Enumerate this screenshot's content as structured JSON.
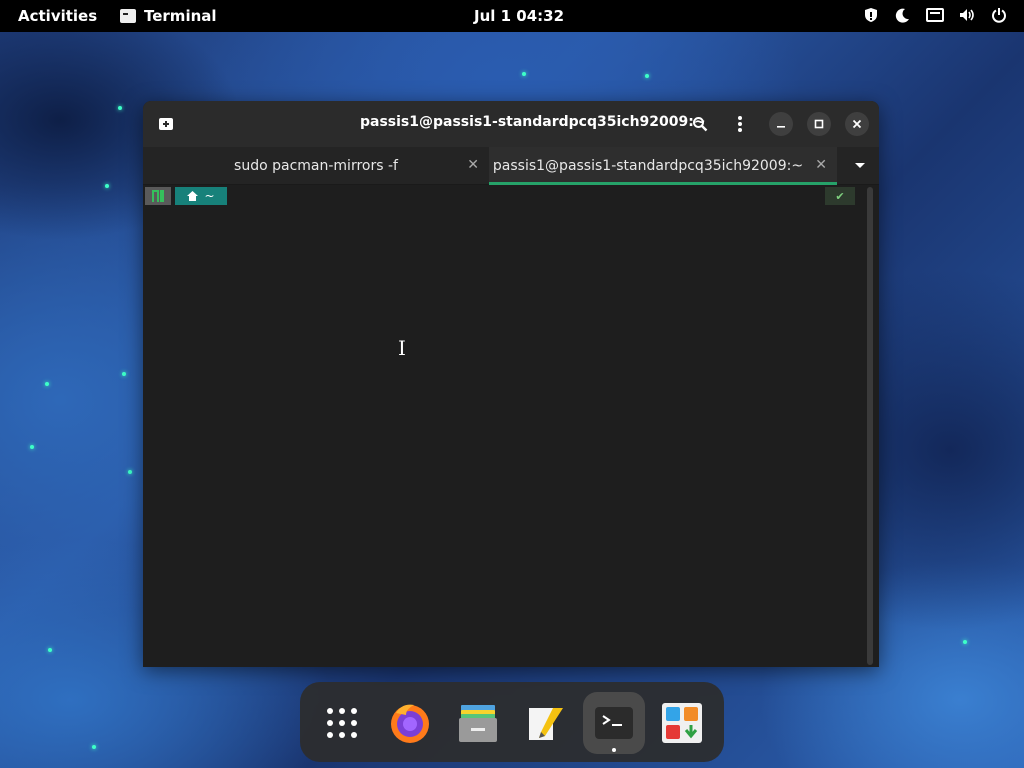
{
  "topbar": {
    "activities": "Activities",
    "app_name": "Terminal",
    "clock": "Jul 1  04:32",
    "tray": [
      "shield-icon",
      "night-light-icon",
      "display-icon",
      "volume-icon",
      "power-icon"
    ]
  },
  "window": {
    "title": "passis1@passis1-standardpcq35ich92009:~",
    "tabs": [
      {
        "label": "sudo pacman-mirrors -f",
        "active": false
      },
      {
        "label": "passis1@passis1-standardpcq35ich92009:~",
        "active": true
      }
    ]
  },
  "terminal": {
    "prompt_distro": "manjaro-icon",
    "prompt_dir": "~",
    "status": "✔"
  },
  "dock": {
    "items": [
      "app-grid-icon",
      "firefox-icon",
      "file-manager-icon",
      "text-editor-icon",
      "terminal-icon",
      "software-store-icon"
    ]
  },
  "colors": {
    "accent": "#26a269",
    "prompt_teal": "#17817a"
  }
}
